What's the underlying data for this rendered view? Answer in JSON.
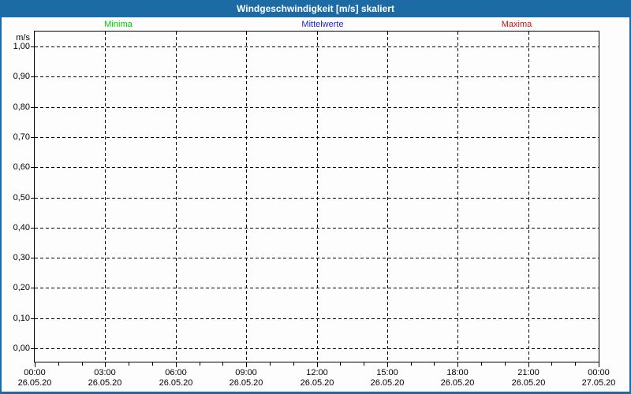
{
  "window": {
    "title": "Windgeschwindigkeit [m/s] skaliert"
  },
  "legend": [
    {
      "label": "Minima",
      "color": "#00cc00"
    },
    {
      "label": "Mittelwerte",
      "color": "#2222cc"
    },
    {
      "label": "Maxima",
      "color": "#cc1111"
    }
  ],
  "colors": {
    "frame_blue": "#1c6ba4",
    "grid_black": "#000000",
    "background": "#fdfdfd"
  },
  "chart_data": {
    "type": "line",
    "title": "Windgeschwindigkeit [m/s] skaliert",
    "ylabel": "m/s",
    "xlabel": "",
    "ylim": [
      0.0,
      1.0
    ],
    "y_ticks": [
      "1,00",
      "0,90",
      "0,80",
      "0,70",
      "0,60",
      "0,50",
      "0,40",
      "0,30",
      "0,20",
      "0,10",
      "0,00"
    ],
    "x_ticks": [
      {
        "time": "00:00",
        "date": "26.05.20"
      },
      {
        "time": "03:00",
        "date": "26.05.20"
      },
      {
        "time": "06:00",
        "date": "26.05.20"
      },
      {
        "time": "09:00",
        "date": "26.05.20"
      },
      {
        "time": "12:00",
        "date": "26.05.20"
      },
      {
        "time": "15:00",
        "date": "26.05.20"
      },
      {
        "time": "18:00",
        "date": "26.05.20"
      },
      {
        "time": "21:00",
        "date": "26.05.20"
      },
      {
        "time": "00:00",
        "date": "27.05.20"
      }
    ],
    "x_minor_ticks_per_hour": 1,
    "hours_per_major_tick": 3,
    "grid": "dashed",
    "legend_position": "top",
    "series": [
      {
        "name": "Minima",
        "color": "#00cc00",
        "values": []
      },
      {
        "name": "Mittelwerte",
        "color": "#2222cc",
        "values": []
      },
      {
        "name": "Maxima",
        "color": "#cc1111",
        "values": []
      }
    ],
    "no_data_drawn": true
  }
}
